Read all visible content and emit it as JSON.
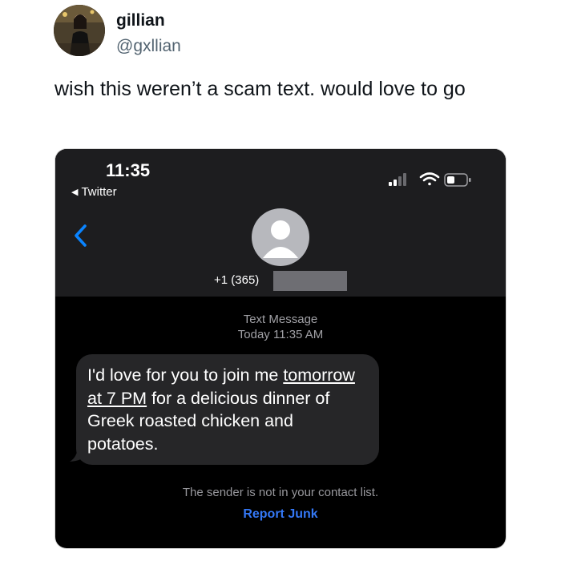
{
  "tweet": {
    "author_name": "gillian",
    "author_handle": "@gxllian",
    "text": "wish this weren’t a scam text. would love to go"
  },
  "phone": {
    "status_bar": {
      "time": "11:35",
      "back_app_label": "Twitter",
      "icons": [
        "signal-icon",
        "wifi-icon",
        "battery-icon"
      ]
    },
    "conversation": {
      "contact_number_prefix": "+1 (365)",
      "meta_type": "Text Message",
      "meta_time": "Today 11:35 AM",
      "message": {
        "before_link": "I'd love for you to join me ",
        "link_text": "tomorrow at 7 PM",
        "after_link": " for a delicious dinner of Greek roasted chicken and potatoes."
      },
      "sender_note": "The sender is not in your contact list.",
      "report_junk_label": "Report Junk"
    },
    "colors": {
      "header_bg": "#1d1d1f",
      "body_bg": "#000000",
      "bubble_bg": "#262628",
      "link_blue": "#3478f6",
      "back_chevron_blue": "#0a84ff"
    }
  }
}
